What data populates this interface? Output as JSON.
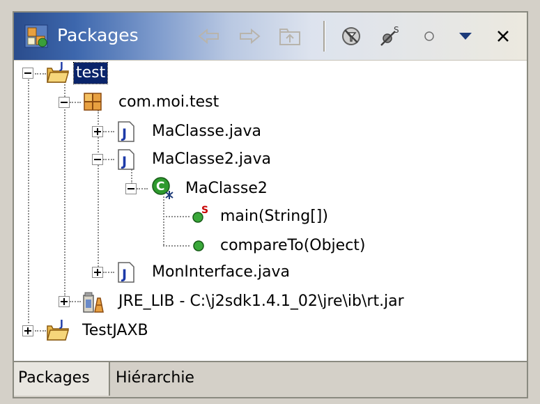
{
  "view": {
    "title": "Packages",
    "toolbar": {
      "back_icon": "back-arrow-icon",
      "forward_icon": "forward-arrow-icon",
      "up_icon": "up-folder-icon",
      "filter_icon": "filter-icon",
      "static_filter_icon": "static-member-filter-icon",
      "link_icon": "link-with-editor-icon",
      "menu_icon": "view-menu-icon",
      "close_icon": "close-icon"
    }
  },
  "tree": [
    {
      "id": "test",
      "label": "test",
      "icon": "java-project-icon",
      "expanded": true,
      "selected": true
    },
    {
      "id": "pkg",
      "label": "com.moi.test",
      "icon": "package-icon",
      "expanded": true
    },
    {
      "id": "maclasse",
      "label": "MaClasse.java",
      "icon": "java-file-icon",
      "expanded": false
    },
    {
      "id": "maclasse2",
      "label": "MaClasse2.java",
      "icon": "java-file-icon",
      "expanded": true
    },
    {
      "id": "class",
      "label": "MaClasse2",
      "icon": "class-icon",
      "expanded": true
    },
    {
      "id": "main",
      "label": "main(String[])",
      "icon": "static-method-icon"
    },
    {
      "id": "compare",
      "label": "compareTo(Object)",
      "icon": "method-icon"
    },
    {
      "id": "moninterface",
      "label": "MonInterface.java",
      "icon": "java-file-icon",
      "expanded": false
    },
    {
      "id": "jre",
      "label": "JRE_LIB - C:\\j2sdk1.4.1_02\\jre\\ib\\rt.jar",
      "icon": "jar-library-icon",
      "expanded": false
    },
    {
      "id": "testjaxb",
      "label": "TestJAXB",
      "icon": "java-project-icon",
      "expanded": false
    }
  ],
  "tabs": [
    {
      "label": "Packages",
      "active": true
    },
    {
      "label": "Hiérarchie",
      "active": false
    }
  ],
  "colors": {
    "selection": "#0a246a",
    "title_gradient_start": "#2a4c8c",
    "method_green": "#2e9a2e",
    "static_red": "#c80000"
  }
}
